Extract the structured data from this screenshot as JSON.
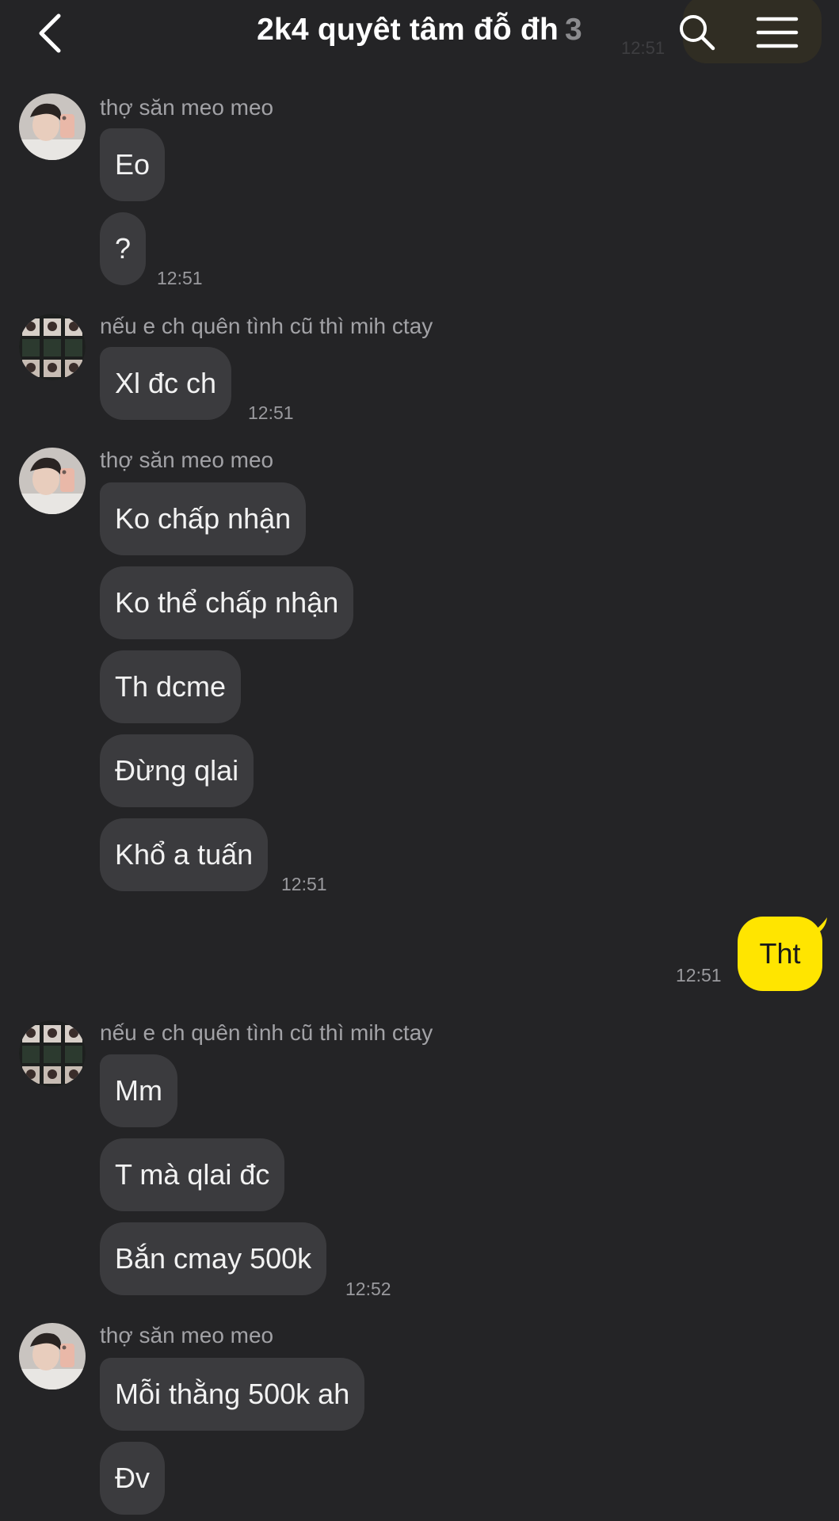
{
  "header": {
    "title": "2k4 quyêt tâm đỗ đh",
    "member_count": "3",
    "ghost_time": "12:51"
  },
  "colors": {
    "background": "#242426",
    "bubble_other": "#3b3b3e",
    "bubble_me": "#ffe500",
    "sender_name": "#a2a2a6",
    "timestamp": "#9a9a9e"
  },
  "messages": {
    "g1": {
      "sender": "thợ săn meo meo",
      "m1": "Eo",
      "m2": "?",
      "time": "12:51"
    },
    "g2": {
      "sender": "nếu e ch quên tình cũ thì mih ctay",
      "m1": "Xl đc ch",
      "time": "12:51"
    },
    "g3": {
      "sender": "thợ săn meo meo",
      "m1": "Ko chấp nhận",
      "m2": "Ko thể chấp nhận",
      "m3": "Th dcme",
      "m4": "Đừng qlai",
      "m5": "Khổ a tuấn",
      "time": "12:51"
    },
    "me": {
      "text": "Tht",
      "time": "12:51"
    },
    "g4": {
      "sender": "nếu e ch quên tình cũ thì mih ctay",
      "m1": "Mm",
      "m2": "T mà qlai đc",
      "m3": "Bắn cmay 500k",
      "time": "12:52"
    },
    "g5": {
      "sender": "thợ săn meo meo",
      "m1": "Mỗi thằng 500k ah",
      "m2": "Đv"
    }
  },
  "icons": {
    "back": "chevron-left-icon",
    "search": "search-icon",
    "menu": "hamburger-menu-icon"
  }
}
